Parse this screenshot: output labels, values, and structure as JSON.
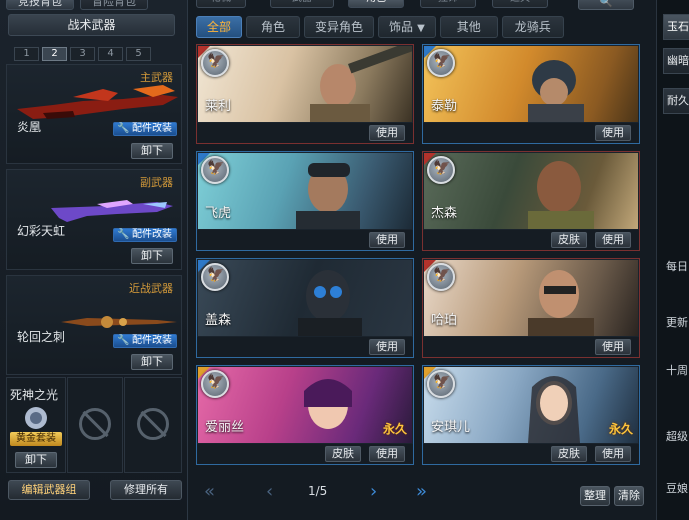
{
  "top_tabs": [
    "竞技背包",
    "冒险背包"
  ],
  "tactical_weapons": "战术武器",
  "slots": [
    "1",
    "2",
    "3",
    "4",
    "5"
  ],
  "active_slot": "2",
  "weapons": [
    {
      "type": "主武器",
      "name": "炎凰",
      "mod": "配件改装",
      "unequip": "卸下"
    },
    {
      "type": "副武器",
      "name": "幻彩天虹",
      "mod": "配件改装",
      "unequip": "卸下"
    },
    {
      "type": "近战武器",
      "name": "轮回之刺",
      "mod": "配件改装",
      "unequip": "卸下"
    }
  ],
  "grenade": {
    "name": "死神之光",
    "badge": "黄金套装",
    "unequip": "卸下"
  },
  "bottom_buttons": {
    "edit_kit": "编辑武器组",
    "repair_all": "修理所有"
  },
  "main_top_tabs": [
    "枪械",
    "武器",
    "角色",
    "挂饰",
    "道具"
  ],
  "filters": [
    "全部",
    "角色",
    "变异角色",
    "饰品",
    "其他",
    "龙骑兵"
  ],
  "active_filter": "全部",
  "characters": [
    {
      "name": "莱利",
      "buttons": [
        "使用"
      ],
      "permanent": ""
    },
    {
      "name": "泰勒",
      "buttons": [
        "使用"
      ],
      "permanent": ""
    },
    {
      "name": "飞虎",
      "buttons": [
        "使用"
      ],
      "permanent": ""
    },
    {
      "name": "杰森",
      "buttons": [
        "皮肤",
        "使用"
      ],
      "permanent": ""
    },
    {
      "name": "盖森",
      "buttons": [
        "使用"
      ],
      "permanent": ""
    },
    {
      "name": "哈珀",
      "buttons": [
        "使用"
      ],
      "permanent": ""
    },
    {
      "name": "爱丽丝",
      "buttons": [
        "皮肤",
        "使用"
      ],
      "permanent": "永久"
    },
    {
      "name": "安琪儿",
      "buttons": [
        "皮肤",
        "使用"
      ],
      "permanent": "永久"
    }
  ],
  "pagination": {
    "current": "1/5"
  },
  "actions": {
    "sort": "整理",
    "clear": "清除"
  },
  "right_strip": {
    "tabs": [
      "玉石",
      "幽暗",
      "耐久"
    ],
    "texts": [
      "每日",
      "更新",
      "十周",
      "超级",
      "豆娘"
    ]
  }
}
